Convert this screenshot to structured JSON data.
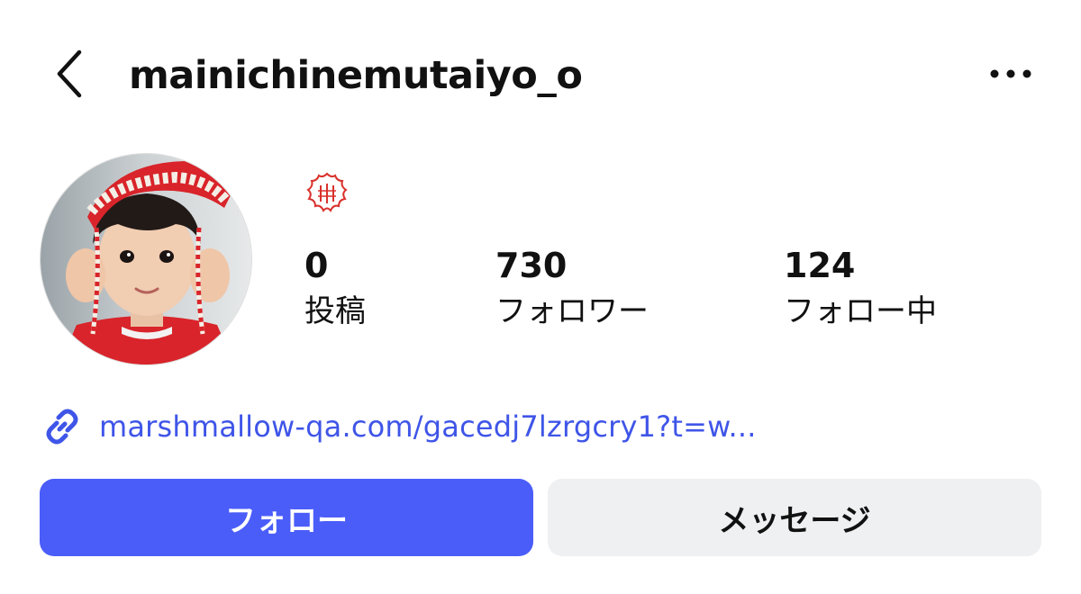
{
  "header": {
    "username": "mainichinemutaiyo_o",
    "back_icon": "chevron-left-icon",
    "more_icon": "more-horizontal-icon"
  },
  "profile": {
    "avatar_icon": "avatar-photo",
    "badge_icon": "red-seal-icon"
  },
  "stats": [
    {
      "count": "0",
      "label": "投稿"
    },
    {
      "count": "730",
      "label": "フォロワー"
    },
    {
      "count": "124",
      "label": "フォロー中"
    }
  ],
  "link": {
    "icon": "link-icon",
    "text": "marshmallow-qa.com/gacedj7lzrgcry1?t=w..."
  },
  "actions": {
    "follow_label": "フォロー",
    "message_label": "メッセージ"
  },
  "colors": {
    "accent": "#4a5df9",
    "link": "#3f55e8",
    "secondary_button": "#eff0f2",
    "seal_red": "#d9312c"
  }
}
